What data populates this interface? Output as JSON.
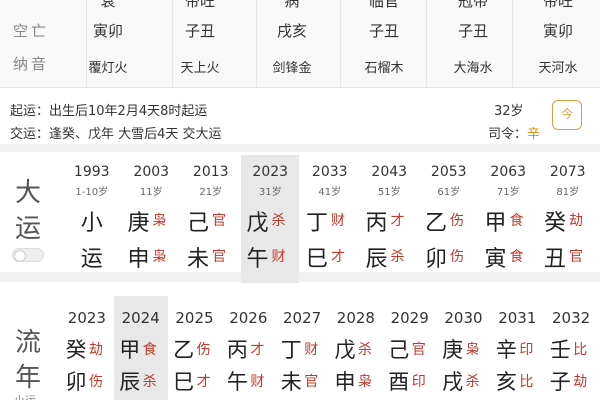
{
  "chart": {
    "top_row": [
      "衰",
      "帝旺",
      "病",
      "临官",
      "冠带",
      "帝旺"
    ],
    "row_labels": [
      "空亡",
      "纳音"
    ],
    "kongwang": [
      "寅卯",
      "子丑",
      "戌亥",
      "子丑",
      "子丑",
      "寅卯"
    ],
    "nayin": [
      "覆灯火",
      "天上火",
      "剑锋金",
      "石榴木",
      "大海水",
      "天河水"
    ]
  },
  "info": {
    "qiyun_label": "起运：",
    "qiyun_text": "出生后10年2月4天8时起运",
    "jiaoyun_label": "交运：",
    "jiaoyun_text": "逢癸、戊年 大雪后4天 交大运",
    "age": "32岁",
    "siling_label": "司令：",
    "siling_value": "辛",
    "cal_icon": "今"
  },
  "dayun": {
    "label": [
      "大",
      "运"
    ],
    "columns": [
      {
        "year": "1993",
        "age": "1-10岁",
        "gan": "小",
        "zhi": "运",
        "gan_god": "",
        "zhi_god": ""
      },
      {
        "year": "2003",
        "age": "11岁",
        "gan": "庚",
        "zhi": "申",
        "gan_god": "枭",
        "zhi_god": "枭"
      },
      {
        "year": "2013",
        "age": "21岁",
        "gan": "己",
        "zhi": "未",
        "gan_god": "官",
        "zhi_god": "官"
      },
      {
        "year": "2023",
        "age": "31岁",
        "gan": "戊",
        "zhi": "午",
        "gan_god": "杀",
        "zhi_god": "财"
      },
      {
        "year": "2033",
        "age": "41岁",
        "gan": "丁",
        "zhi": "巳",
        "gan_god": "财",
        "zhi_god": "才"
      },
      {
        "year": "2043",
        "age": "51岁",
        "gan": "丙",
        "zhi": "辰",
        "gan_god": "才",
        "zhi_god": "杀"
      },
      {
        "year": "2053",
        "age": "61岁",
        "gan": "乙",
        "zhi": "卯",
        "gan_god": "伤",
        "zhi_god": "伤"
      },
      {
        "year": "2063",
        "age": "71岁",
        "gan": "甲",
        "zhi": "寅",
        "gan_god": "食",
        "zhi_god": "食"
      },
      {
        "year": "2073",
        "age": "81岁",
        "gan": "癸",
        "zhi": "丑",
        "gan_god": "劫",
        "zhi_god": "官"
      }
    ]
  },
  "liunian": {
    "label": [
      "流",
      "年"
    ],
    "sub_label": "小运",
    "columns": [
      {
        "year": "2023",
        "gan": "癸",
        "zhi": "卯",
        "gan_god": "劫",
        "zhi_god": "伤"
      },
      {
        "year": "2024",
        "gan": "甲",
        "zhi": "辰",
        "gan_god": "食",
        "zhi_god": "杀"
      },
      {
        "year": "2025",
        "gan": "乙",
        "zhi": "巳",
        "gan_god": "伤",
        "zhi_god": "才"
      },
      {
        "year": "2026",
        "gan": "丙",
        "zhi": "午",
        "gan_god": "才",
        "zhi_god": "财"
      },
      {
        "year": "2027",
        "gan": "丁",
        "zhi": "未",
        "gan_god": "财",
        "zhi_god": "官"
      },
      {
        "year": "2028",
        "gan": "戊",
        "zhi": "申",
        "gan_god": "杀",
        "zhi_god": "枭"
      },
      {
        "year": "2029",
        "gan": "己",
        "zhi": "酉",
        "gan_god": "官",
        "zhi_god": "印"
      },
      {
        "year": "2030",
        "gan": "庚",
        "zhi": "戌",
        "gan_god": "枭",
        "zhi_god": "杀"
      },
      {
        "year": "2031",
        "gan": "辛",
        "zhi": "亥",
        "gan_god": "印",
        "zhi_god": "比"
      },
      {
        "year": "2032",
        "gan": "壬",
        "zhi": "子",
        "gan_god": "比",
        "zhi_god": "劫"
      }
    ]
  }
}
